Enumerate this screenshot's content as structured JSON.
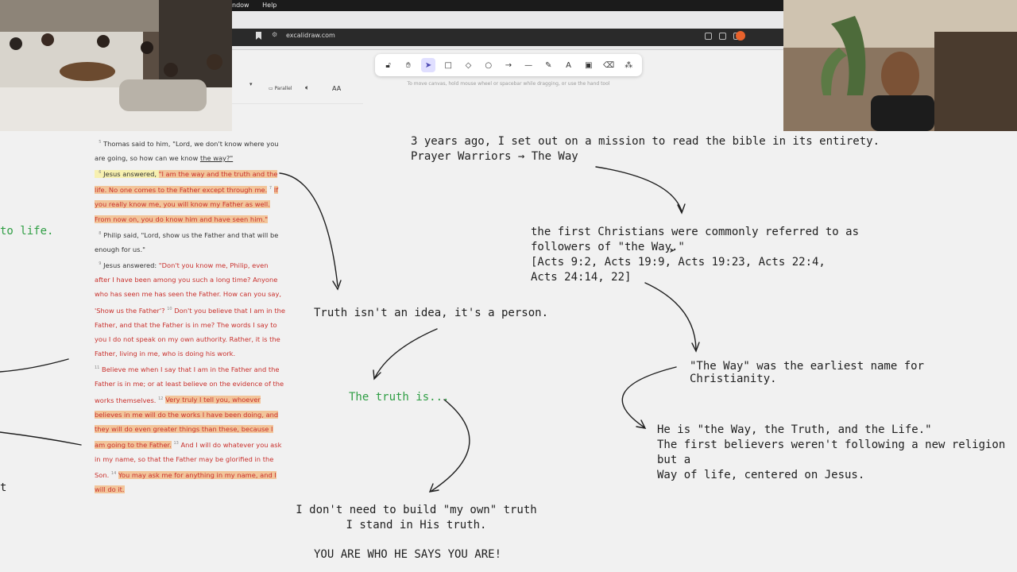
{
  "menubar": {
    "items": [
      "ndow",
      "Help"
    ]
  },
  "browser": {
    "url": "excalidraw.com"
  },
  "toolbar": {
    "tools": [
      {
        "name": "lock-icon",
        "glyph": "🔓︎"
      },
      {
        "name": "hand-icon",
        "glyph": "✋︎"
      },
      {
        "name": "selection-icon",
        "glyph": "➤",
        "active": true
      },
      {
        "name": "rectangle-icon",
        "glyph": "□"
      },
      {
        "name": "diamond-icon",
        "glyph": "◇"
      },
      {
        "name": "ellipse-icon",
        "glyph": "○"
      },
      {
        "name": "arrow-icon",
        "glyph": "→"
      },
      {
        "name": "line-icon",
        "glyph": "—"
      },
      {
        "name": "pencil-icon",
        "glyph": "✎"
      },
      {
        "name": "text-icon",
        "glyph": "A"
      },
      {
        "name": "image-icon",
        "glyph": "▣"
      },
      {
        "name": "eraser-icon",
        "glyph": "⌫"
      },
      {
        "name": "more-tools-icon",
        "glyph": "⁂"
      }
    ],
    "hint": "To move canvas, hold mouse wheel or spacebar while dragging, or use the hand tool"
  },
  "reader": {
    "parallel_label": "Parallel",
    "font_size_label": "AA"
  },
  "bible": {
    "v5_num": "5",
    "v5": "Thomas said to him, \"Lord, we don't know where you are going, so how can we know ",
    "v5_end": "the way?\"",
    "v6_num": "6",
    "v6_intro": "Jesus answered, ",
    "v6_red": "\"I am the way and the truth and the life. No one comes to the Father except through me.",
    "v7_num": "7",
    "v7_red": "If you really know me, you will know my Father as well. From now on, you do know him and have seen him.\"",
    "v8_num": "8",
    "v8": "Philip said, \"Lord, show us the Father and that will be enough for us.\"",
    "v9_num": "9",
    "v9_intro": "Jesus answered: ",
    "v9_red": "\"Don't you know me, Philip, even after I have been among you such a long time? Anyone who has seen me has seen the Father. How can you say, 'Show us the Father'?",
    "v10_num": "10",
    "v10_red": "Don't you believe that I am in the Father, and that the Father is in me? The words I say to you I do not speak on my own authority. Rather, it is the Father, living in me, who is doing his work.",
    "v11_num": "11",
    "v11_red": "Believe me when I say that I am in the Father and the Father is in me; or at least believe on the evidence of the works themselves.",
    "v12_num": "12",
    "v12_red": "Very truly I tell you, whoever believes in me will do the works I have been doing, and they will do even greater things than these, because I am going to the Father.",
    "v13_num": "13",
    "v13_red": "And I will do whatever you ask in my name, so that the Father may be glorified in the Son.",
    "v14_num": "14",
    "v14_red": "You may ask me for anything in my name, and I will do it."
  },
  "notes": {
    "left_cut_1": "to life.",
    "left_cut_2": "t",
    "truth_person": "Truth isn't an idea, it's a person.",
    "truth_is": "The truth is...",
    "own_truth_1": "I don't need to build \"my own\" truth",
    "own_truth_2": "I stand in His truth.",
    "who_he_says": "YOU ARE WHO HE SAYS YOU ARE!",
    "mission_1": "3 years ago, I set out on a mission to read the bible in its entirety.",
    "mission_2": "Prayer Warriors → The Way",
    "christians_1": "the first Christians were commonly referred to as",
    "christians_2": "followers of \"the Way.\"",
    "christians_3": "[Acts 9:2, Acts 19:9, Acts 19:23, Acts 22:4,",
    "christians_4": "Acts 24:14, 22]",
    "earliest_name": "\"The Way\" was the earliest name for Christianity.",
    "he_is_1": "He is \"the Way, the Truth, and the Life.\"",
    "he_is_2": "The first believers weren't following a new religion but a",
    "he_is_3": "Way of life, centered on Jesus."
  },
  "colors": {
    "green_text": "#2f9e44",
    "red_letter": "#c9302c",
    "highlight": "#f2c59a"
  }
}
